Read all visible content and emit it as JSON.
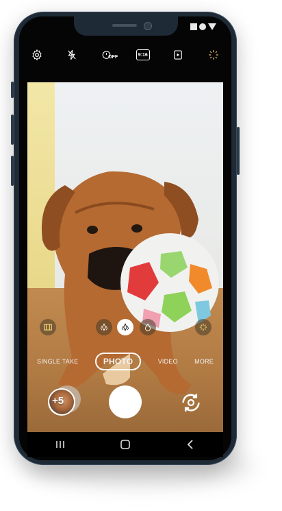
{
  "topbar": {
    "icons": [
      "settings-icon",
      "flash-off-icon",
      "timer-off-icon",
      "aspect-ratio-icon",
      "motion-photo-icon",
      "filter-icon"
    ],
    "aspect_label": "9:16",
    "timer_label": "OFF"
  },
  "scene_tools": [
    "video-frame-icon",
    "bokeh-icon",
    "bokeh-active-icon",
    "drop-icon",
    "scene-optimizer-icon"
  ],
  "modes": {
    "items": [
      "SINGLE TAKE",
      "PHOTO",
      "VIDEO",
      "MORE"
    ],
    "selected": "PHOTO"
  },
  "gallery": {
    "count": "+5"
  },
  "colors": {
    "accent": "#ffffff",
    "bezel": "#1e2a36",
    "screen_bg": "#050505"
  }
}
